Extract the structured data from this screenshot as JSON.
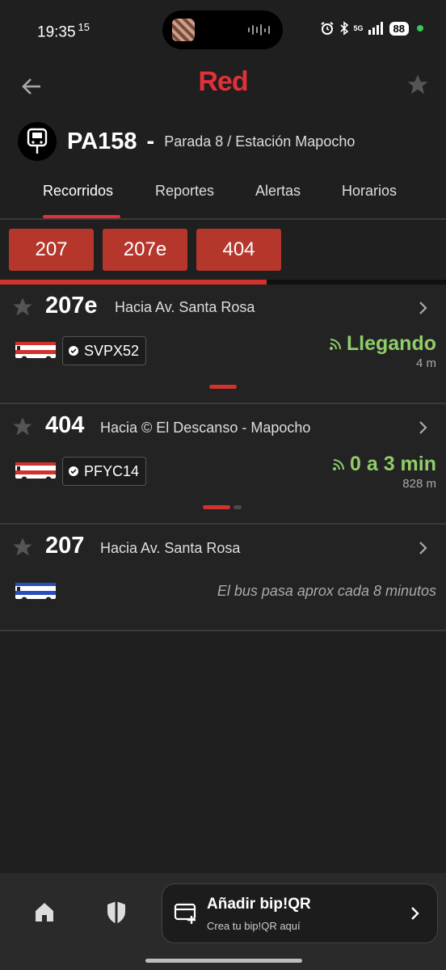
{
  "status_bar": {
    "time": "19:35",
    "temp": "15",
    "network": "5G",
    "battery": "88"
  },
  "app": {
    "logo": "Red"
  },
  "stop": {
    "code": "PA158",
    "separator": "-",
    "name": "Parada 8 / Estación Mapocho"
  },
  "tabs": [
    {
      "label": "Recorridos",
      "active": true
    },
    {
      "label": "Reportes",
      "active": false
    },
    {
      "label": "Alertas",
      "active": false
    },
    {
      "label": "Horarios",
      "active": false
    }
  ],
  "route_chips": [
    "207",
    "207e",
    "404"
  ],
  "arrivals": [
    {
      "route": "207e",
      "direction": "Hacia Av. Santa Rosa",
      "plate": "SVPX52",
      "eta": "Llegando",
      "distance": "4 m"
    },
    {
      "route": "404",
      "direction": "Hacia © El Descanso - Mapocho",
      "plate": "PFYC14",
      "eta": "0 a 3 min",
      "distance": "828 m"
    },
    {
      "route": "207",
      "direction": "Hacia Av. Santa Rosa",
      "frequency": "El bus pasa aprox cada 8 minutos"
    }
  ],
  "bottom_bar": {
    "bip_title": "Añadir bip!QR",
    "bip_subtitle": "Crea tu bip!QR aquí"
  },
  "colors": {
    "brand_red": "#e0303a",
    "chip_red": "#b5362b",
    "eta_green": "#8fcd6a",
    "background": "#1f1f1f"
  }
}
